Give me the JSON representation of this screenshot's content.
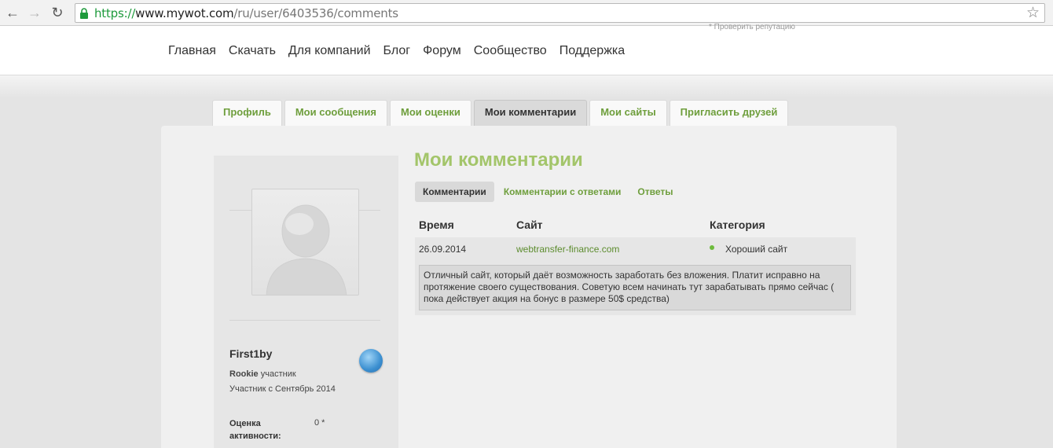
{
  "browser": {
    "url_scheme": "https://",
    "url_host": "www.mywot.com",
    "url_path": "/ru/user/6403536/comments"
  },
  "header": {
    "check_reputation": "* Проверить репутацию",
    "nav": [
      "Главная",
      "Скачать",
      "Для компаний",
      "Блог",
      "Форум",
      "Сообщество",
      "Поддержка"
    ]
  },
  "tabs": [
    "Профиль",
    "Мои сообщения",
    "Мои оценки",
    "Мои комментарии",
    "Мои сайты",
    "Пригласить друзей"
  ],
  "active_tab": "Мои комментарии",
  "profile": {
    "username": "First1by",
    "rank_level": "Rookie",
    "rank_suffix": " участник",
    "member_since": "Участник с Сентябрь 2014",
    "activity_label": "Оценка активности:",
    "activity_value": "0 *"
  },
  "main": {
    "title": "Мои комментарии",
    "subtabs": [
      "Комментарии",
      "Комментарии с ответами",
      "Ответы"
    ],
    "columns": [
      "Время",
      "Сайт",
      "Категория"
    ],
    "rows": [
      {
        "time": "26.09.2014",
        "site": "webtransfer-finance.com",
        "category": "Хороший сайт",
        "category_color": "#6dbb3c",
        "comment": "Отличный сайт, который даёт возможность заработать без вложения. Платит исправно на протяжение своего существования. Советую всем начинать тут зарабатывать прямо сейчас ( пока действует акция на бонус в размере 50$ средства)"
      }
    ]
  },
  "colors": {
    "accent_green": "#6e9e3c",
    "title_green": "#a3c56a"
  }
}
